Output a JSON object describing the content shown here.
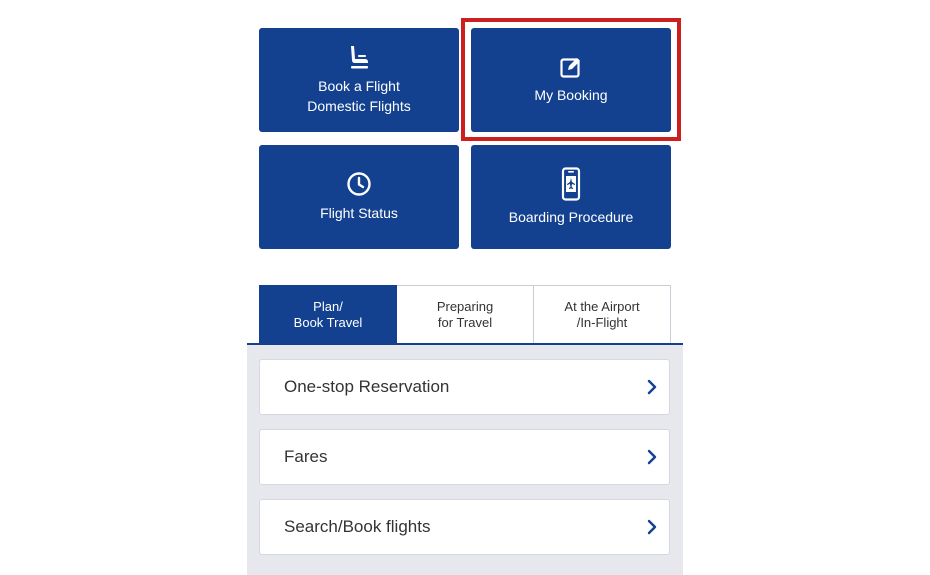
{
  "tiles": {
    "book_flight": {
      "line1": "Book a Flight",
      "line2": "Domestic Flights",
      "icon": "seat-icon"
    },
    "my_booking": {
      "label": "My Booking",
      "icon": "edit-icon"
    },
    "flight_status": {
      "label": "Flight Status",
      "icon": "clock-icon"
    },
    "boarding_procedure": {
      "label": "Boarding Procedure",
      "icon": "mobile-boarding-pass-icon"
    }
  },
  "tabs": [
    {
      "label": "Plan/\nBook Travel",
      "active": true
    },
    {
      "label": "Preparing\nfor Travel",
      "active": false
    },
    {
      "label": "At the Airport\n/In-Flight",
      "active": false
    }
  ],
  "list": [
    {
      "label": "One-stop Reservation"
    },
    {
      "label": "Fares"
    },
    {
      "label": "Search/Book flights"
    }
  ],
  "colors": {
    "brand_blue": "#13418f",
    "highlight_red": "#cc1f1f",
    "list_bg": "#e6e8ee"
  }
}
